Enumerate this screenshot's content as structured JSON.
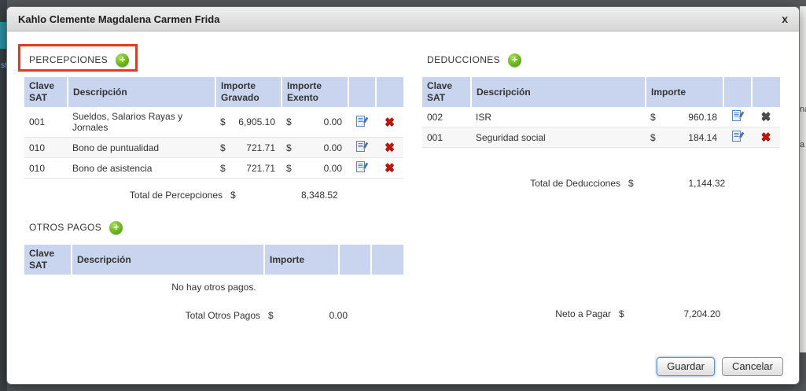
{
  "background": {
    "left_fragment": "st",
    "right_fragments": [
      "na",
      "a"
    ]
  },
  "modal": {
    "title": "Kahlo Clemente Magdalena Carmen Frida",
    "close_label": "x"
  },
  "icons": {
    "add": "green-plus-circle",
    "edit": "blue-edit-note",
    "delete": "red-x",
    "delete_disabled": "gray-x"
  },
  "colors": {
    "table_header_blue": "#c9d5ee",
    "annotation_red": "#e8391c",
    "add_green": "#6cb61d",
    "delete_red": "#c41507"
  },
  "percepciones": {
    "title": "PERCEPCIONES",
    "headers": [
      "Clave SAT",
      "Descripción",
      "Importe Gravado",
      "Importe Exento"
    ],
    "currency": "$",
    "rows": [
      {
        "clave": "001",
        "desc": "Sueldos, Salarios Rayas y Jornales",
        "gravado": "6,905.10",
        "exento": "0.00"
      },
      {
        "clave": "010",
        "desc": "Bono de puntualidad",
        "gravado": "721.71",
        "exento": "0.00"
      },
      {
        "clave": "010",
        "desc": "Bono de asistencia",
        "gravado": "721.71",
        "exento": "0.00"
      }
    ],
    "total_label": "Total de Percepciones",
    "total": "8,348.52"
  },
  "otros_pagos": {
    "title": "OTROS PAGOS",
    "headers": [
      "Clave SAT",
      "Descripción",
      "Importe"
    ],
    "empty_text": "No hay otros pagos.",
    "total_label": "Total Otros Pagos",
    "currency": "$",
    "total": "0.00"
  },
  "deducciones": {
    "title": "DEDUCCIONES",
    "headers": [
      "Clave SAT",
      "Descripción",
      "Importe"
    ],
    "currency": "$",
    "rows": [
      {
        "clave": "002",
        "desc": "ISR",
        "importe": "960.18"
      },
      {
        "clave": "001",
        "desc": "Seguridad social",
        "importe": "184.14"
      }
    ],
    "total_label": "Total de Deducciones",
    "total": "1,144.32"
  },
  "neto": {
    "label": "Neto a Pagar",
    "currency": "$",
    "value": "7,204.20"
  },
  "footer": {
    "save_label": "Guardar",
    "cancel_label": "Cancelar"
  }
}
